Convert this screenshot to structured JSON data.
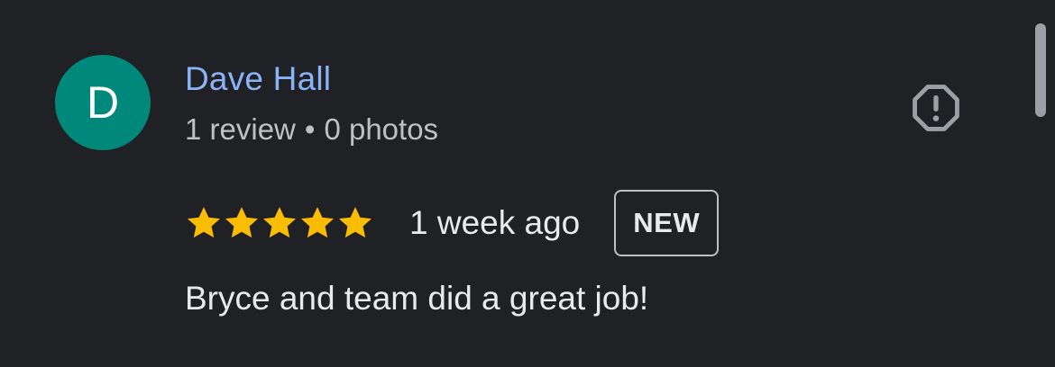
{
  "reviewer": {
    "avatar_letter": "D",
    "avatar_color": "#00897b",
    "name": "Dave Hall",
    "review_count": "1 review",
    "separator": "•",
    "photo_count": "0 photos"
  },
  "review": {
    "rating": 5,
    "rating_max": 5,
    "star_color": "#fbbc04",
    "time": "1 week ago",
    "badge": "NEW",
    "text": "Bryce and team did a great job!"
  },
  "actions": {
    "report_icon": "report-octagon-icon"
  },
  "colors": {
    "background": "#202124",
    "name_link": "#8ab4f8",
    "text_primary": "#e8eaed",
    "text_secondary": "#bdc1c6"
  }
}
